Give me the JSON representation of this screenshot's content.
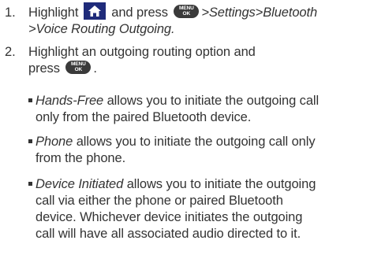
{
  "steps": [
    {
      "number": "1.",
      "part1": "Highlight",
      "part2": "and press",
      "path_line1": ">Settings>Bluetooth",
      "path_line2": ">Voice Routing Outgoing."
    },
    {
      "number": "2.",
      "line1": "Highlight an outgoing routing option and",
      "line2_prefix": "press",
      "line2_suffix": "."
    }
  ],
  "menu_key": {
    "top": "MENU",
    "bottom": "OK"
  },
  "bullets": [
    {
      "term": "Hands-Free",
      "line1": " allows you to initiate the outgoing call",
      "line2": "only from the paired Bluetooth device."
    },
    {
      "term": "Phone",
      "line1": " allows you to initiate the outgoing call only",
      "line2": "from the phone."
    },
    {
      "term": "Device Initiated",
      "line1": " allows you to initiate the outgoing",
      "line2": "call via either the phone or paired Bluetooth",
      "line3": "device. Whichever device initiates the outgoing",
      "line4": "call will have all associated audio directed to it."
    }
  ],
  "colors": {
    "text": "#333333",
    "home_icon_bg": "#1f2b7a",
    "menu_key_bg": "#3a3a3a"
  },
  "icons": {
    "home": "home-icon",
    "menu_ok": "menu-ok-key-icon"
  }
}
